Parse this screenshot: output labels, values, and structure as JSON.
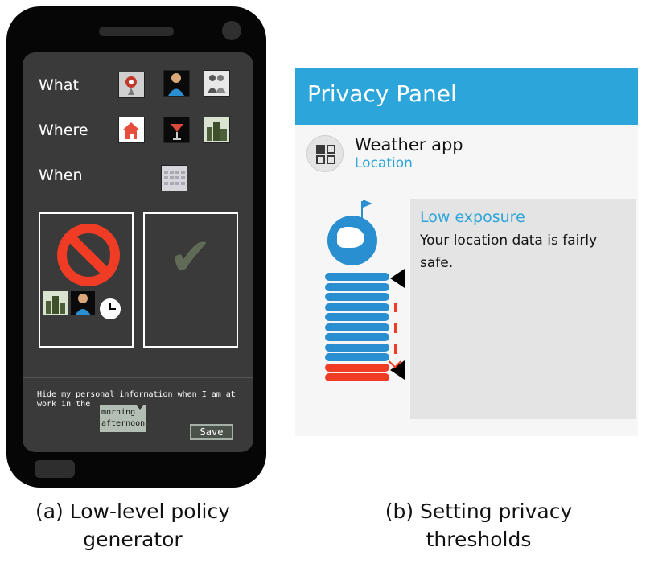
{
  "policy_generator": {
    "rows": [
      {
        "label": "What",
        "icons": [
          "map-pin-icon",
          "person-info-icon",
          "people-group-icon"
        ]
      },
      {
        "label": "Where",
        "icons": [
          "home-icon",
          "cocktail-bar-icon",
          "city-buildings-icon"
        ]
      },
      {
        "label": "When",
        "icons": [
          "calendar-icon"
        ]
      }
    ],
    "deny_icons": [
      "city-buildings-icon",
      "person-info-icon",
      "clock-icon"
    ],
    "sentence": "Hide my personal information when I am at work in the",
    "dropdown_options": [
      "morning",
      "afternoon"
    ],
    "save_label": "Save"
  },
  "privacy_panel": {
    "title": "Privacy Panel",
    "app_name": "Weather app",
    "permission": "Location",
    "exposure_title": "Low exposure",
    "exposure_text": "Your location data is fairly safe.",
    "scale_blue_bars": 9,
    "scale_red_bars": 2
  },
  "captions": {
    "a_line1": "(a) Low-level policy",
    "a_line2": "generator",
    "b_line1": "(b) Setting privacy",
    "b_line2": "thresholds"
  },
  "colors": {
    "panel_header": "#2ca5da",
    "accent_blue": "#2a8fd0",
    "alert_red": "#f03c24",
    "check_green": "#5f6b57"
  }
}
